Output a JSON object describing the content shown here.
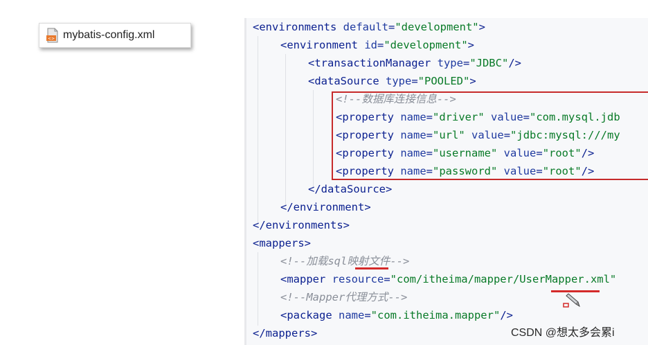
{
  "file_tab": {
    "name": "mybatis-config.xml",
    "icon": "xml-file-icon"
  },
  "code": {
    "lines": [
      {
        "indent": 0,
        "parts": [
          [
            "tag",
            "<environments "
          ],
          [
            "attr",
            "default"
          ],
          [
            "tag",
            "="
          ],
          [
            "val",
            "\"development\""
          ],
          [
            "tag",
            ">"
          ]
        ]
      },
      {
        "indent": 1,
        "parts": [
          [
            "tag",
            "<environment "
          ],
          [
            "attr",
            "id"
          ],
          [
            "tag",
            "="
          ],
          [
            "val",
            "\"development\""
          ],
          [
            "tag",
            ">"
          ]
        ]
      },
      {
        "indent": 2,
        "parts": [
          [
            "tag",
            "<transactionManager "
          ],
          [
            "attr",
            "type"
          ],
          [
            "tag",
            "="
          ],
          [
            "val",
            "\"JDBC\""
          ],
          [
            "tag",
            "/>"
          ]
        ]
      },
      {
        "indent": 2,
        "parts": [
          [
            "tag",
            "<dataSource "
          ],
          [
            "attr",
            "type"
          ],
          [
            "tag",
            "="
          ],
          [
            "val",
            "\"POOLED\""
          ],
          [
            "tag",
            ">"
          ]
        ]
      },
      {
        "indent": 3,
        "parts": [
          [
            "cmt",
            "<!--数据库连接信息-->"
          ]
        ]
      },
      {
        "indent": 3,
        "parts": [
          [
            "tag",
            "<property "
          ],
          [
            "attr",
            "name"
          ],
          [
            "tag",
            "="
          ],
          [
            "val",
            "\"driver\""
          ],
          [
            "tag",
            " "
          ],
          [
            "attr",
            "value"
          ],
          [
            "tag",
            "="
          ],
          [
            "val",
            "\"com.mysql.jdb"
          ]
        ]
      },
      {
        "indent": 3,
        "parts": [
          [
            "tag",
            "<property "
          ],
          [
            "attr",
            "name"
          ],
          [
            "tag",
            "="
          ],
          [
            "val",
            "\"url\""
          ],
          [
            "tag",
            " "
          ],
          [
            "attr",
            "value"
          ],
          [
            "tag",
            "="
          ],
          [
            "val",
            "\"jdbc:mysql:///my"
          ]
        ]
      },
      {
        "indent": 3,
        "parts": [
          [
            "tag",
            "<property "
          ],
          [
            "attr",
            "name"
          ],
          [
            "tag",
            "="
          ],
          [
            "val",
            "\"username\""
          ],
          [
            "tag",
            " "
          ],
          [
            "attr",
            "value"
          ],
          [
            "tag",
            "="
          ],
          [
            "val",
            "\"root\""
          ],
          [
            "tag",
            "/>"
          ]
        ]
      },
      {
        "indent": 3,
        "parts": [
          [
            "tag",
            "<property "
          ],
          [
            "attr",
            "name"
          ],
          [
            "tag",
            "="
          ],
          [
            "val",
            "\"password\""
          ],
          [
            "tag",
            " "
          ],
          [
            "attr",
            "value"
          ],
          [
            "tag",
            "="
          ],
          [
            "val",
            "\"root\""
          ],
          [
            "tag",
            "/>"
          ]
        ]
      },
      {
        "indent": 2,
        "parts": [
          [
            "tag",
            "</dataSource>"
          ]
        ]
      },
      {
        "indent": 1,
        "parts": [
          [
            "tag",
            "</environment>"
          ]
        ]
      },
      {
        "indent": 0,
        "parts": [
          [
            "tag",
            "</environments>"
          ]
        ]
      },
      {
        "indent": 0,
        "parts": [
          [
            "tag",
            "<mappers>"
          ]
        ]
      },
      {
        "indent": 1,
        "parts": [
          [
            "cmt",
            "<!--加载sql映射文件-->"
          ]
        ]
      },
      {
        "indent": 1,
        "parts": [
          [
            "tag",
            "<mapper "
          ],
          [
            "attr",
            "resource"
          ],
          [
            "tag",
            "="
          ],
          [
            "val",
            "\"com/itheima/mapper/UserMapper.xml\""
          ]
        ]
      },
      {
        "indent": 1,
        "parts": [
          [
            "cmt",
            "<!--Mapper代理方式-->"
          ]
        ]
      },
      {
        "indent": 1,
        "parts": [
          [
            "tag",
            "<package "
          ],
          [
            "attr",
            "name"
          ],
          [
            "tag",
            "="
          ],
          [
            "val",
            "\"com.itheima.mapper\""
          ],
          [
            "tag",
            "/>"
          ]
        ]
      },
      {
        "indent": 0,
        "parts": [
          [
            "tag",
            "</mappers>"
          ]
        ]
      }
    ]
  },
  "watermark": "CSDN @想太多会累i",
  "colors": {
    "highlight_box": "#c62a2a",
    "tag": "#0a1f8f",
    "value": "#087a27",
    "comment": "#8a8f99"
  }
}
